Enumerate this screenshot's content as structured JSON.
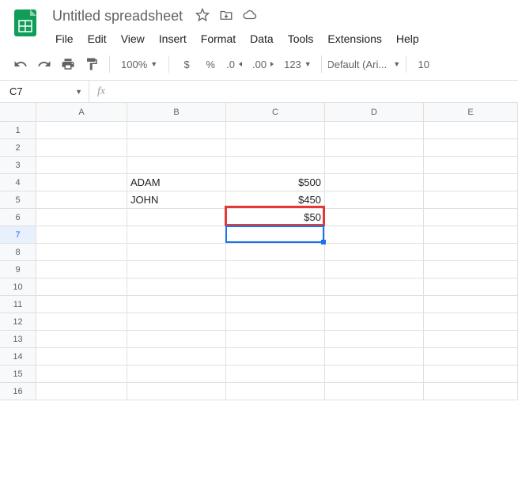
{
  "doc_title": "Untitled spreadsheet",
  "menu": [
    "File",
    "Edit",
    "View",
    "Insert",
    "Format",
    "Data",
    "Tools",
    "Extensions",
    "Help"
  ],
  "toolbar": {
    "zoom": "100%",
    "currency": "$",
    "percent": "%",
    "dec_less": ".0",
    "dec_more": ".00",
    "num_fmt": "123",
    "font": "Default (Ari...",
    "font_size": "10"
  },
  "name_box": "C7",
  "formula": "",
  "columns": [
    "A",
    "B",
    "C",
    "D",
    "E"
  ],
  "rows": 16,
  "active_row": 7,
  "cells": {
    "B4": "ADAM",
    "C4": "$500",
    "B5": "JOHN",
    "C5": "$450",
    "C6": "$50"
  },
  "selection": {
    "col": "C",
    "row": 7
  },
  "highlight": {
    "col": "C",
    "row": 6
  }
}
